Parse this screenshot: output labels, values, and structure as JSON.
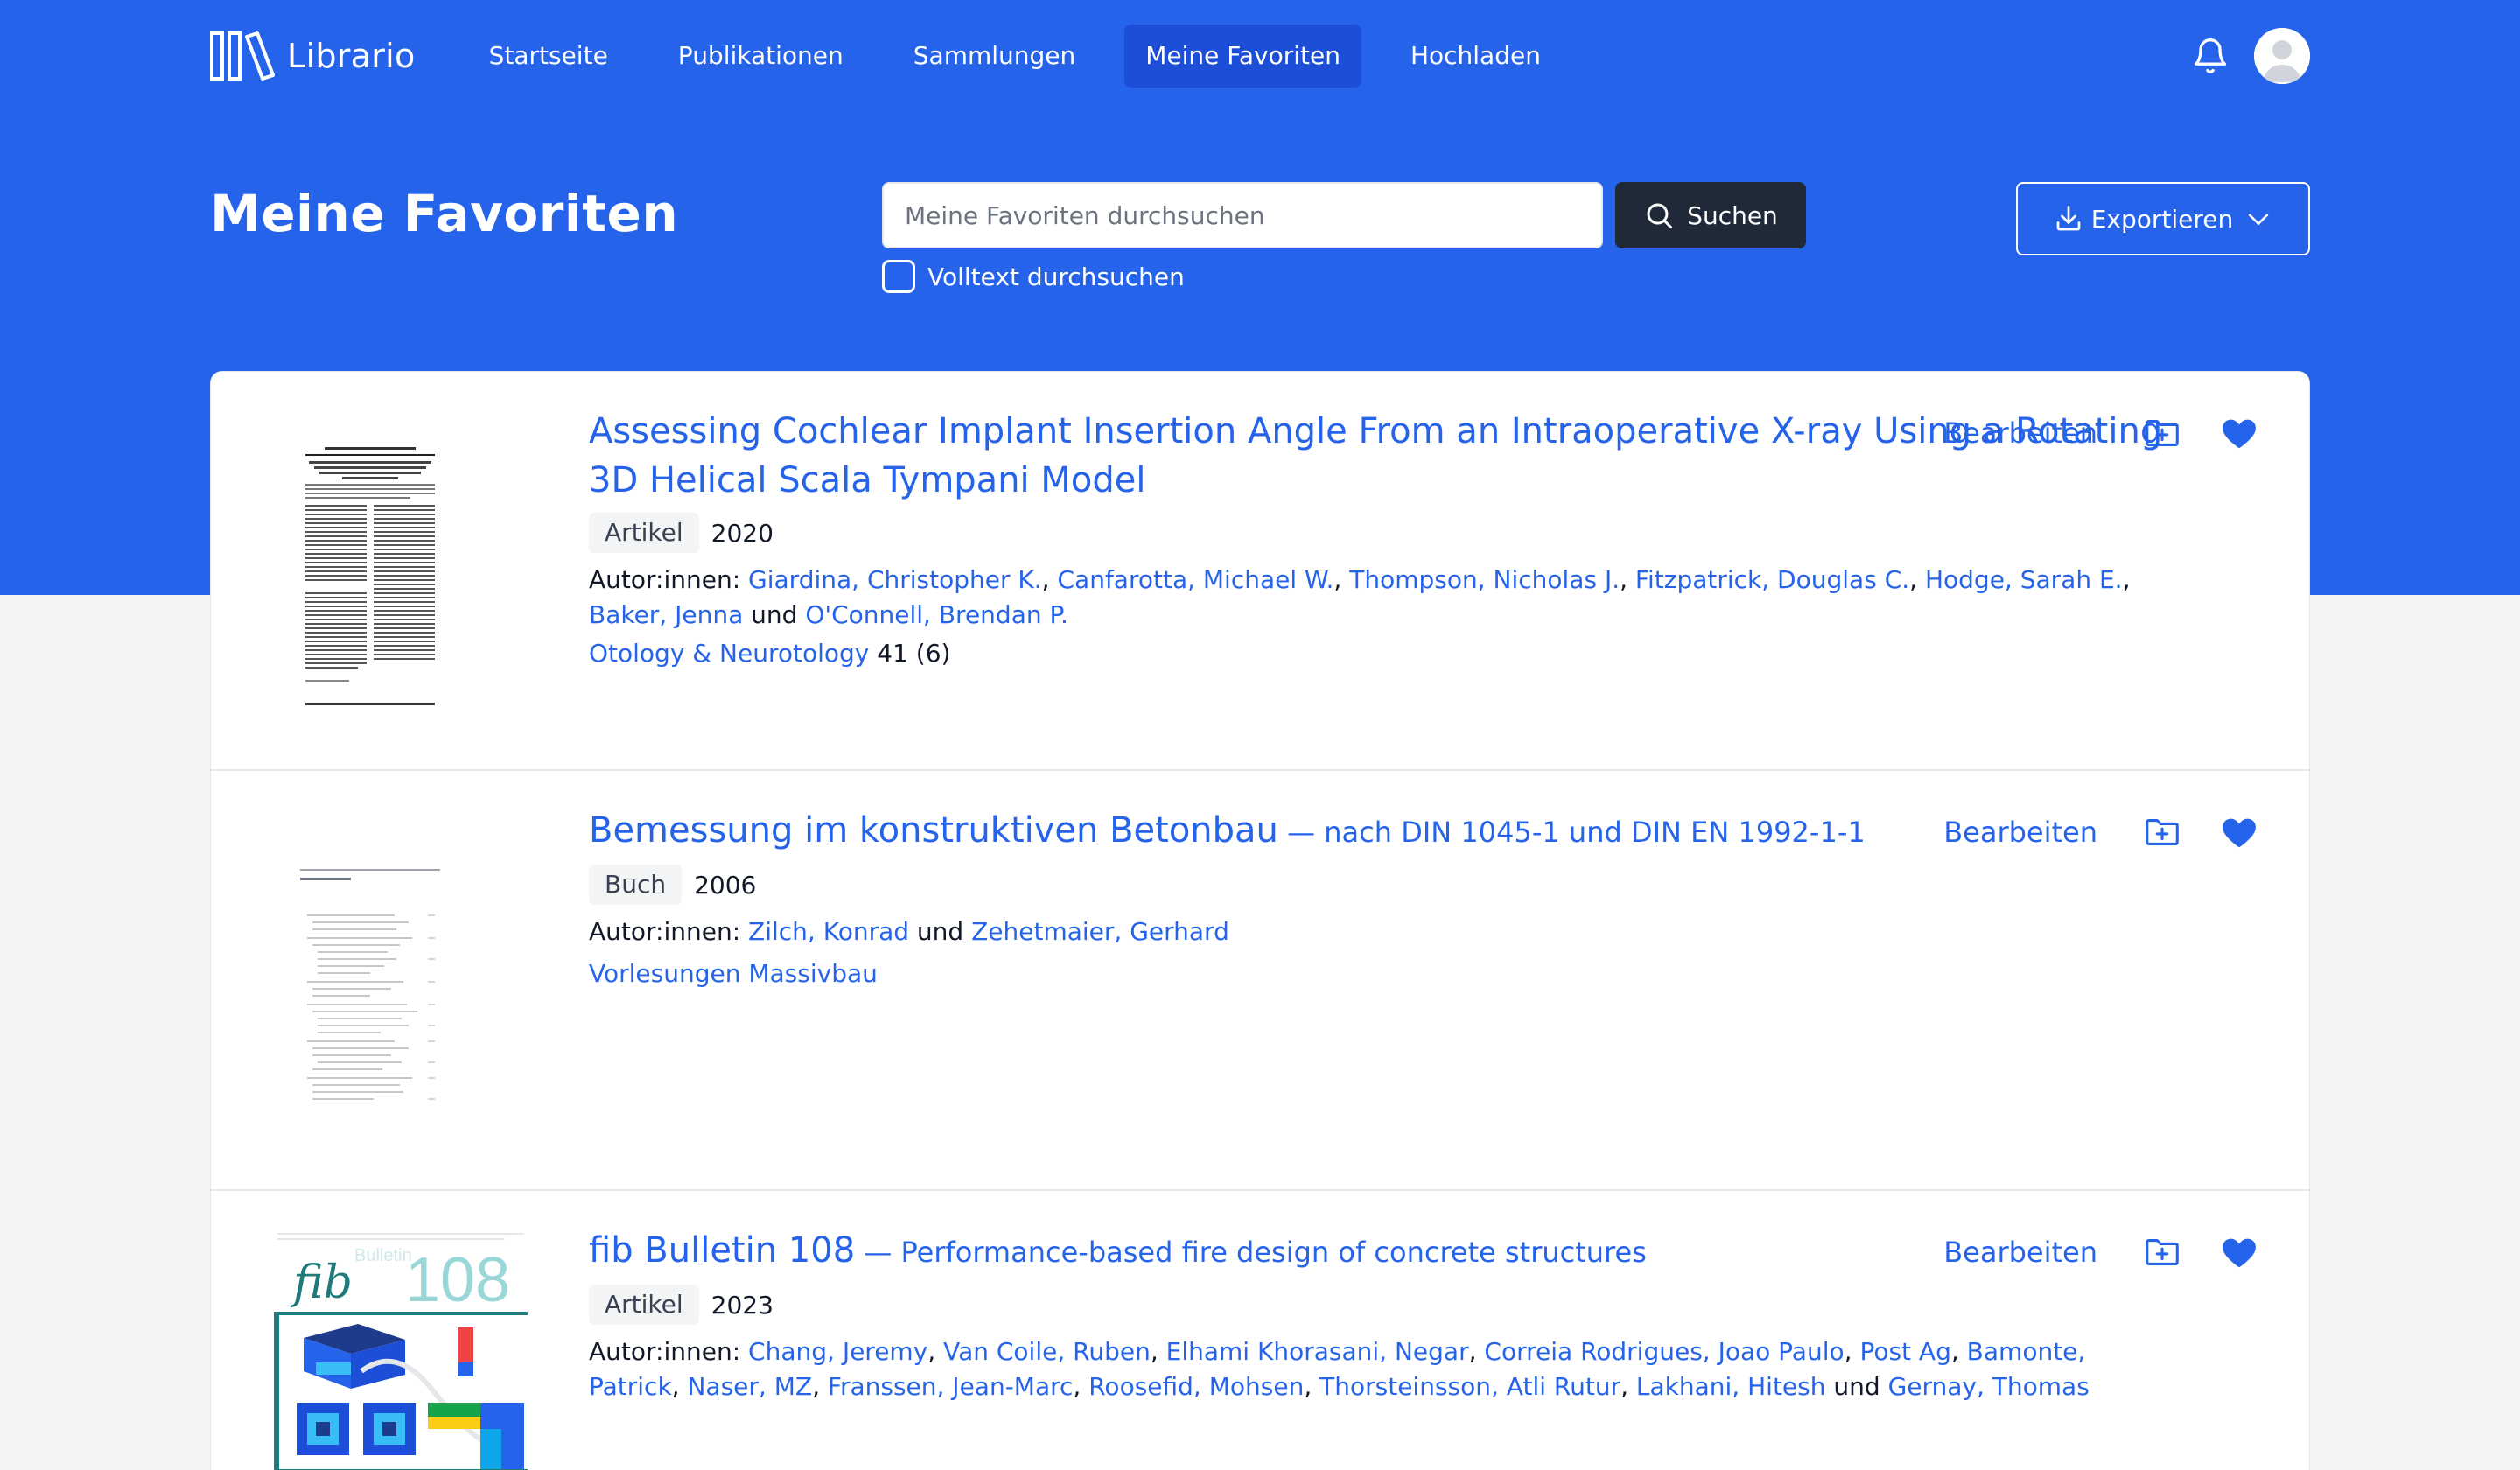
{
  "nav": {
    "logo_text": "Librario",
    "items": [
      {
        "label": "Startseite",
        "active": false
      },
      {
        "label": "Publikationen",
        "active": false
      },
      {
        "label": "Sammlungen",
        "active": false
      },
      {
        "label": "Meine Favoriten",
        "active": true
      },
      {
        "label": "Hochladen",
        "active": false
      }
    ],
    "notification_icon": "bell-icon",
    "avatar_icon": "user-avatar-icon"
  },
  "header": {
    "title": "Meine Favoriten",
    "search": {
      "placeholder": "Meine Favoriten durchsuchen",
      "value": "",
      "button_label": "Suchen"
    },
    "fulltext_label": "Volltext durchsuchen",
    "fulltext_checked": false,
    "export_label": "Exportieren"
  },
  "colors": {
    "primary": "#2563eb",
    "dark_button": "#1f2937",
    "active_nav": "#1d4ed8"
  },
  "items": [
    {
      "title": "Assessing Cochlear Implant Insertion Angle From an Intraoperative X-ray Using a Rotating 3D Helical Scala Tympani Model",
      "subtitle": "",
      "type": "Artikel",
      "year": "2020",
      "authors_label": "Autor:innen:",
      "authors": [
        "Giardina, Christopher K.",
        "Canfarotta, Michael W.",
        "Thompson, Nicholas J.",
        "Fitzpatrick, Douglas C.",
        "Hodge, Sarah E.",
        "Baker, Jenna",
        "O'Connell, Brendan P."
      ],
      "and_word": "und",
      "source": "Otology & Neurotology",
      "source_detail": " 41 (6)",
      "edit_label": "Bearbeiten",
      "favorite": true
    },
    {
      "title": "Bemessung im konstruktiven Betonbau",
      "subtitle": " — nach DIN 1045-1 und DIN EN 1992-1-1",
      "type": "Buch",
      "year": "2006",
      "authors_label": "Autor:innen:",
      "authors": [
        "Zilch, Konrad",
        "Zehetmaier, Gerhard"
      ],
      "and_word": "und",
      "source": "Vorlesungen Massivbau",
      "source_detail": "",
      "edit_label": "Bearbeiten",
      "favorite": true
    },
    {
      "title": "fib Bulletin 108",
      "subtitle": " — Performance-based fire design of concrete structures",
      "type": "Artikel",
      "year": "2023",
      "authors_label": "Autor:innen:",
      "authors": [
        "Chang, Jeremy",
        "Van Coile, Ruben",
        "Elhami Khorasani, Negar",
        "Correia Rodrigues, Joao Paulo",
        "Post Ag",
        "Bamonte, Patrick",
        "Naser, MZ",
        "Franssen, Jean-Marc",
        "Roosefid, Mohsen",
        "Thorsteinsson, Atli Rutur",
        "Lakhani, Hitesh",
        "Gernay, Thomas"
      ],
      "and_word": "und",
      "source": "",
      "source_detail": "",
      "edit_label": "Bearbeiten",
      "favorite": true,
      "cover_text": {
        "brand": "fib",
        "number": "108",
        "series": "Bulletin"
      }
    }
  ]
}
